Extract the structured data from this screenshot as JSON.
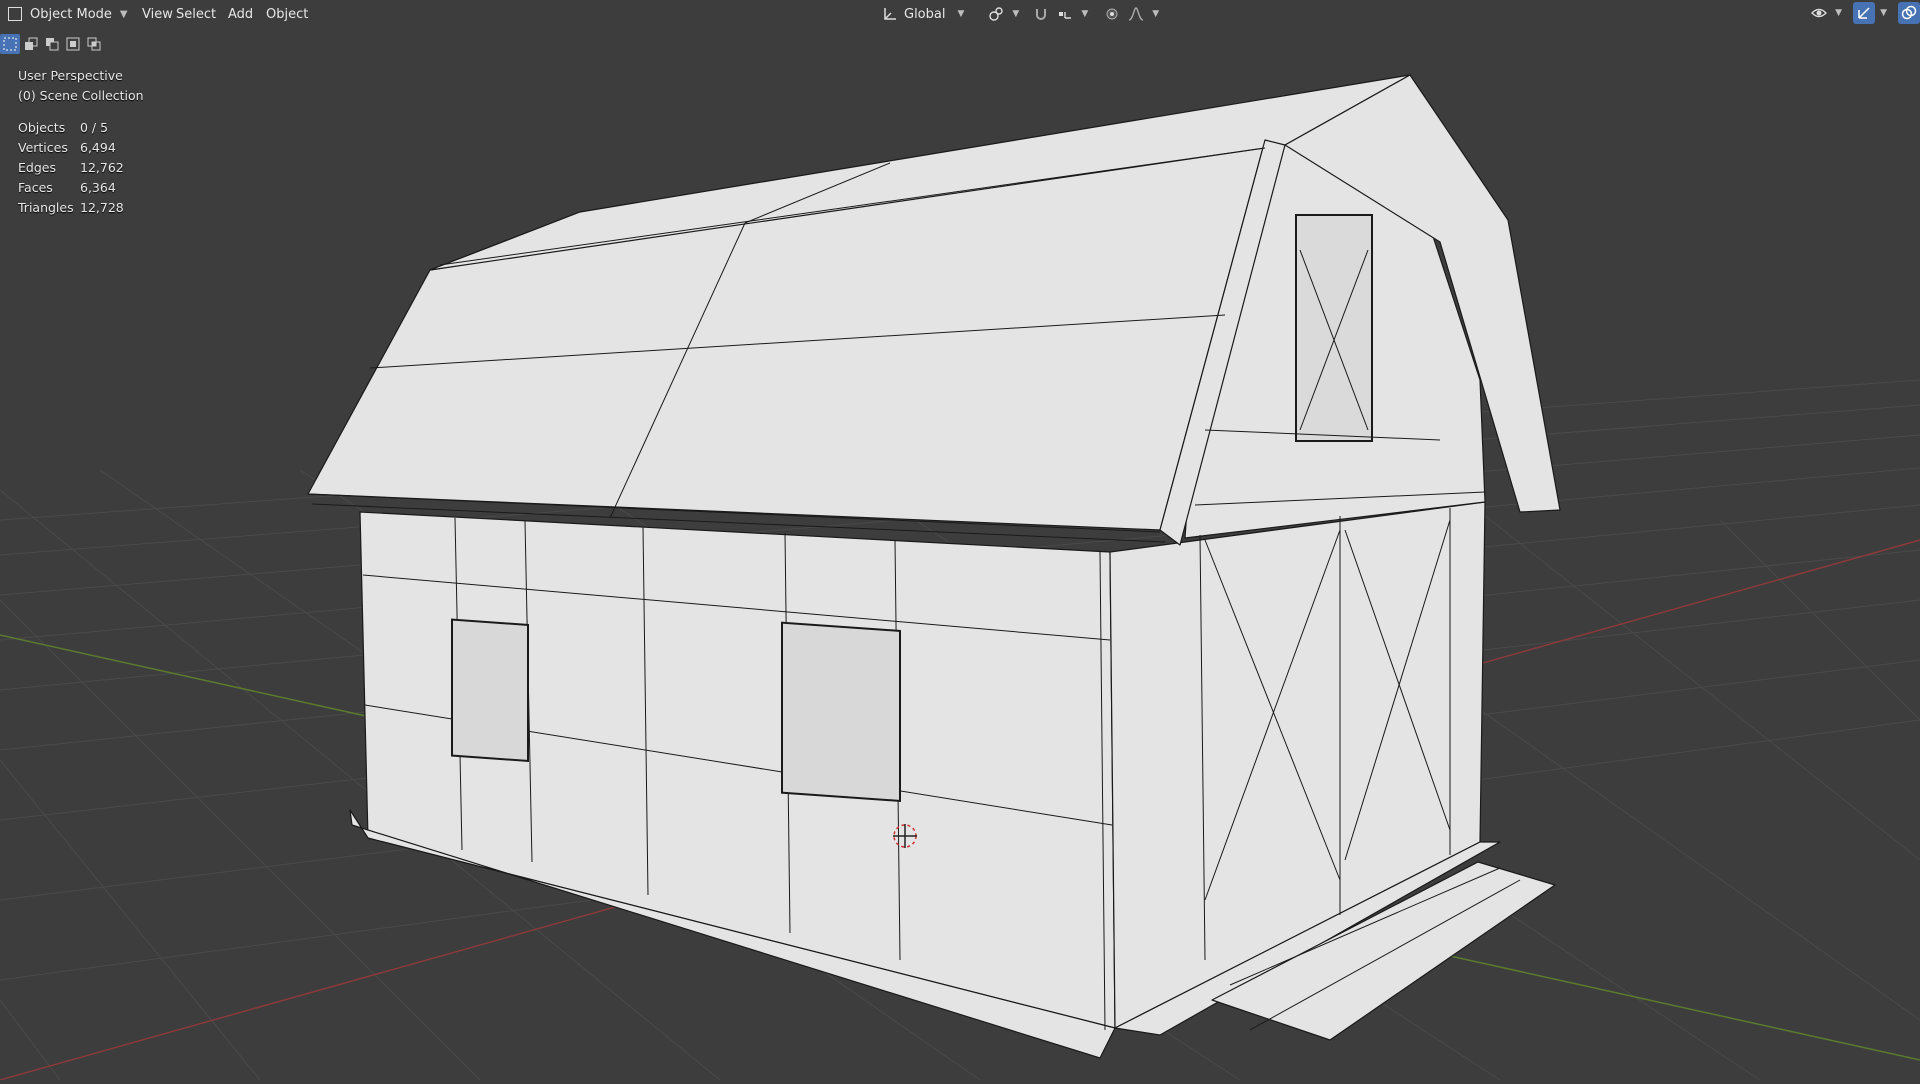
{
  "header": {
    "mode": "Object Mode",
    "menus": [
      "View",
      "Select",
      "Add",
      "Object"
    ],
    "transform_orientation": "Global"
  },
  "overlay": {
    "view_name": "User Perspective",
    "collection": "(0) Scene Collection",
    "stats": [
      {
        "label": "Objects",
        "value": "0 / 5"
      },
      {
        "label": "Vertices",
        "value": "6,494"
      },
      {
        "label": "Edges",
        "value": "12,762"
      },
      {
        "label": "Faces",
        "value": "6,364"
      },
      {
        "label": "Triangles",
        "value": "12,728"
      }
    ]
  },
  "colors": {
    "viewport_bg": "#3d3d3d",
    "grid": "#4a4a4a",
    "x_axis": "#8a3a3a",
    "y_axis": "#5c7a2e",
    "mesh_face": "#e4e4e4",
    "mesh_wire": "#1a1a1a",
    "accent": "#4772b3"
  },
  "icons": {
    "mode": "object-mode-icon",
    "orientation": "transform-orientation-icon",
    "pivot": "pivot-point-icon",
    "snap": "snap-magnet-icon",
    "snap_target": "snap-increment-icon",
    "proportional": "proportional-editing-icon",
    "falloff": "falloff-curve-icon",
    "visibility": "eye-visibility-icon",
    "gizmo": "gizmo-icon",
    "overlays": "overlays-icon"
  }
}
